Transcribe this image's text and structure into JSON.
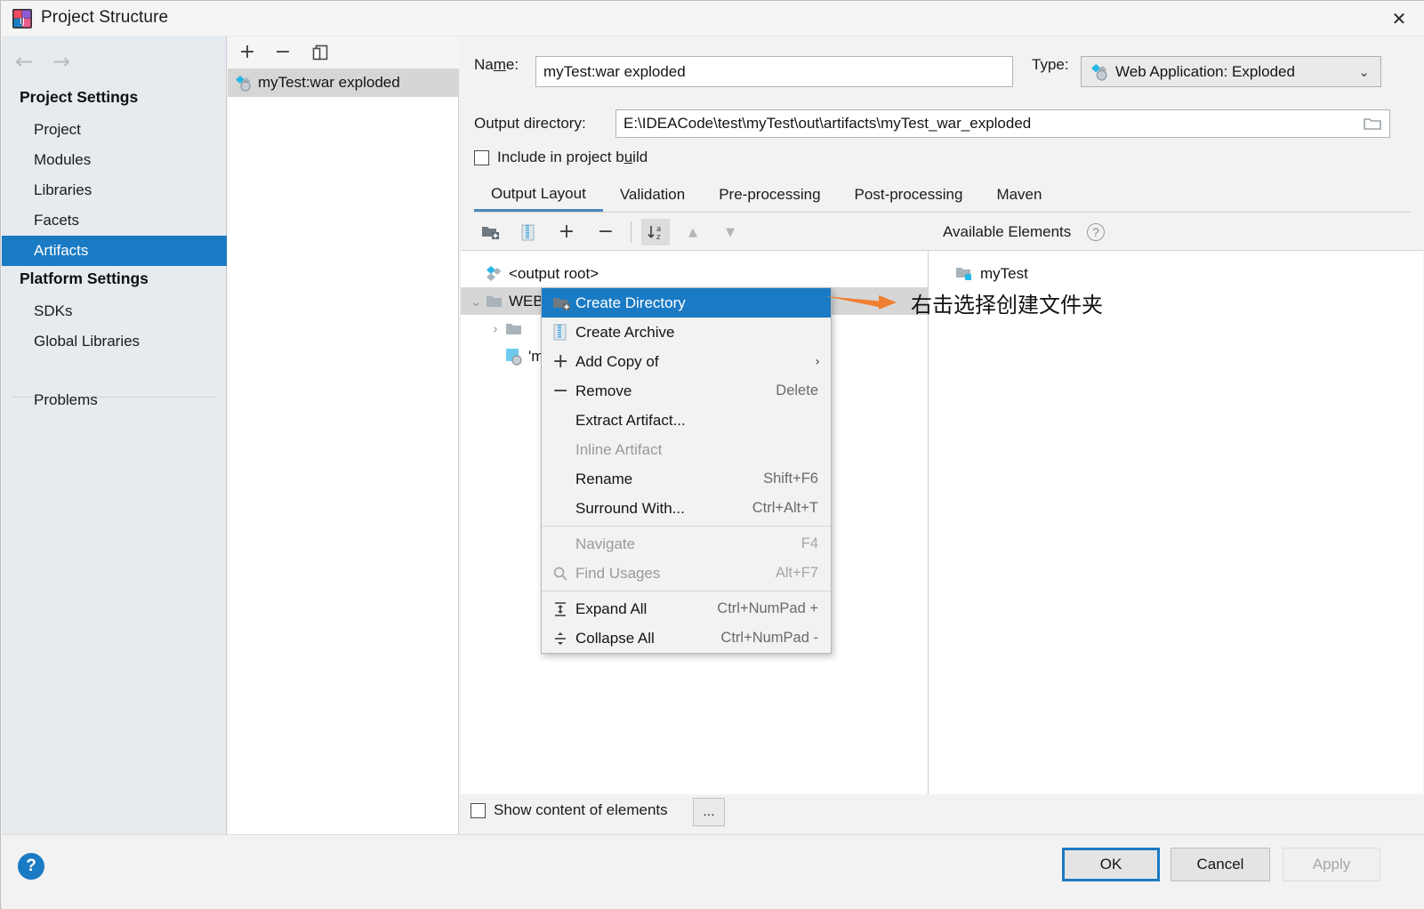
{
  "window": {
    "title": "Project Structure",
    "close_label": "✕",
    "app_icon": "intellij-idea-icon"
  },
  "sidebar": {
    "back_icon": "arrow-left-icon",
    "forward_icon": "arrow-right-icon",
    "groups": [
      {
        "title": "Project Settings",
        "items": [
          "Project",
          "Modules",
          "Libraries",
          "Facets",
          "Artifacts"
        ]
      },
      {
        "title": "Platform Settings",
        "items": [
          "SDKs",
          "Global Libraries"
        ]
      }
    ],
    "selected": "Artifacts",
    "extra_items": [
      "Problems"
    ]
  },
  "artifacts_panel": {
    "toolbar": {
      "add": "+",
      "remove": "−",
      "copy": "copy-icon"
    },
    "items": [
      {
        "label": "myTest:war exploded",
        "selected": true
      }
    ]
  },
  "form": {
    "name_label_pre": "Na",
    "name_label_accel": "m",
    "name_label_post": "e:",
    "name_value": "myTest:war exploded",
    "type_label": "Type:",
    "type_value": "Web Application: Exploded",
    "type_caret": "⌄",
    "outdir_label": "Output directory:",
    "outdir_value": "E:\\IDEACode\\test\\myTest\\out\\artifacts\\myTest_war_exploded",
    "browse_icon": "folder-open-icon",
    "include_label_pre": "Include in project b",
    "include_label_accel": "u",
    "include_label_post": "ild",
    "include_checked": false
  },
  "tabs": {
    "items": [
      "Output Layout",
      "Validation",
      "Pre-processing",
      "Post-processing",
      "Maven"
    ],
    "active": "Output Layout"
  },
  "output_toolbar": {
    "buttons": [
      {
        "name": "create-directory-icon",
        "label": ""
      },
      {
        "name": "create-archive-icon",
        "label": ""
      },
      {
        "name": "add-icon",
        "label": "+"
      },
      {
        "name": "remove-icon",
        "label": "−"
      },
      {
        "name": "sort-az-icon",
        "label": "",
        "pressed": true
      },
      {
        "name": "move-up-icon",
        "label": "▲"
      },
      {
        "name": "move-down-icon",
        "label": "▼"
      }
    ],
    "available_elements_label": "Available Elements",
    "help_icon": "?"
  },
  "output_tree": {
    "nodes": [
      {
        "label": "<output root>",
        "icon": "artifact-icon",
        "indent": 0,
        "twisty": ""
      },
      {
        "label": "WEB-INF",
        "icon": "folder-icon",
        "indent": 0,
        "twisty": "⌄",
        "selected": true
      },
      {
        "label": "",
        "icon": "folder-icon",
        "indent": 1,
        "twisty": "›"
      },
      {
        "label": "'myTest' compile output",
        "icon": "module-output-icon",
        "indent": 1,
        "twisty": ""
      }
    ]
  },
  "available_tree": {
    "nodes": [
      {
        "label": "myTest",
        "icon": "module-folder-icon"
      }
    ]
  },
  "context_menu": {
    "items": [
      {
        "label": "Create Directory",
        "accel": "",
        "icon": "create-directory-icon",
        "state": "highlight"
      },
      {
        "label": "Create Archive",
        "accel": "",
        "icon": "create-archive-icon",
        "state": "normal"
      },
      {
        "label": "Add Copy of",
        "accel": "",
        "icon": "plus-icon",
        "state": "normal",
        "submenu": "›"
      },
      {
        "label": "Remove",
        "accel": "Delete",
        "icon": "minus-icon",
        "state": "normal"
      },
      {
        "label": "Extract Artifact...",
        "accel": "",
        "icon": "",
        "state": "normal"
      },
      {
        "label": "Inline Artifact",
        "accel": "",
        "icon": "",
        "state": "disabled"
      },
      {
        "label": "Rename",
        "accel": "Shift+F6",
        "icon": "",
        "state": "normal"
      },
      {
        "label": "Surround With...",
        "accel": "Ctrl+Alt+T",
        "icon": "",
        "state": "normal"
      },
      {
        "separator": true
      },
      {
        "label": "Navigate",
        "accel": "F4",
        "icon": "",
        "state": "disabled"
      },
      {
        "label": "Find Usages",
        "accel": "Alt+F7",
        "icon": "search-icon",
        "state": "disabled"
      },
      {
        "separator": true
      },
      {
        "label": "Expand All",
        "accel": "Ctrl+NumPad +",
        "icon": "expand-all-icon",
        "state": "normal"
      },
      {
        "label": "Collapse All",
        "accel": "Ctrl+NumPad -",
        "icon": "collapse-all-icon",
        "state": "normal"
      }
    ]
  },
  "annotation": {
    "text": "右击选择创建文件夹",
    "arrow_color": "#ef8033"
  },
  "bottom": {
    "show_content_label": "Show content of elements",
    "show_content_checked": false,
    "ellipsis_label": "..."
  },
  "footer": {
    "help_label": "?",
    "ok_label": "OK",
    "cancel_label": "Cancel",
    "apply_label": "Apply"
  },
  "colors": {
    "accent": "#1a7ac4",
    "annotation_orange": "#ef8033",
    "sidebar_bg": "#e6ebef",
    "selection_gray": "#d6d6d6"
  }
}
